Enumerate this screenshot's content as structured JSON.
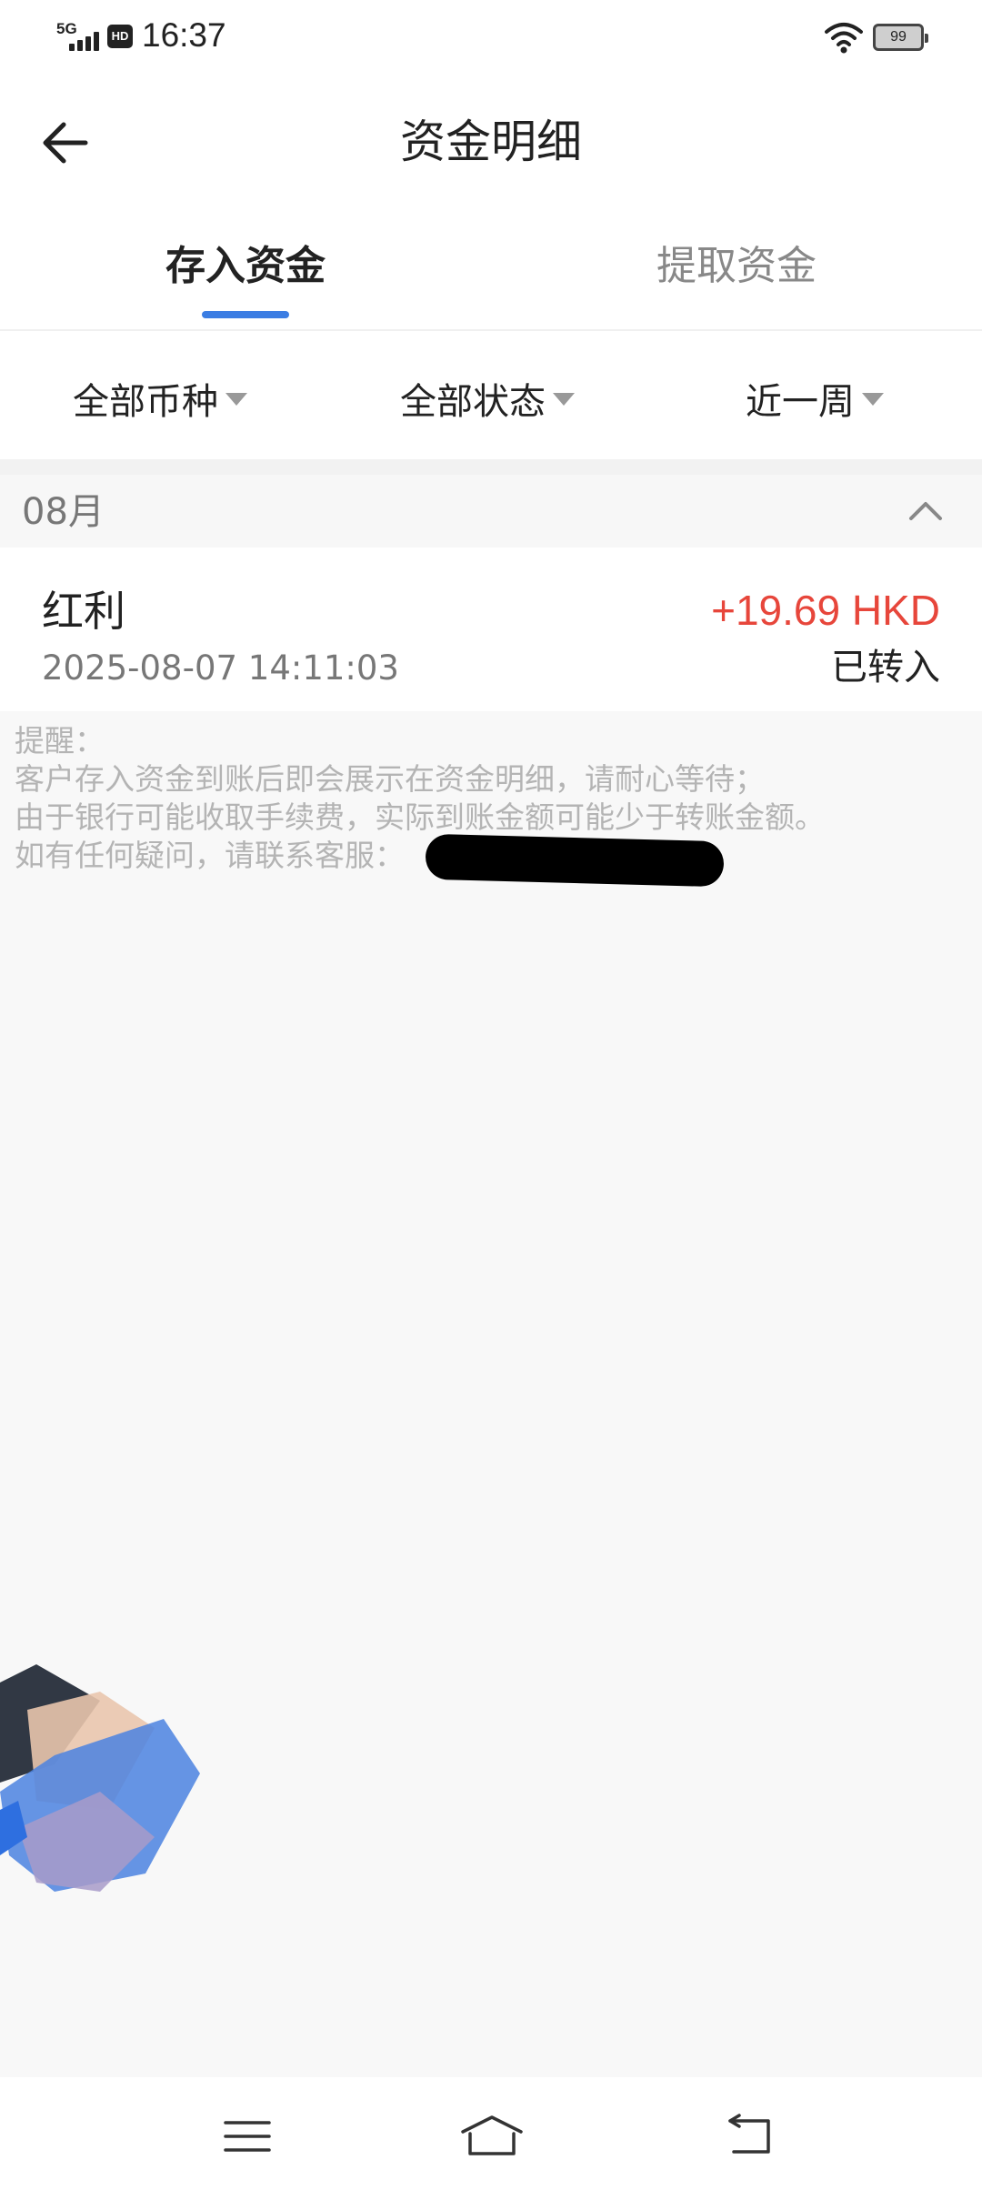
{
  "status_bar": {
    "network": "5G",
    "hd": "HD",
    "time": "16:37",
    "battery": "99",
    "icons": [
      "signal-icon",
      "wifi-icon",
      "battery-icon"
    ]
  },
  "header": {
    "title": "资金明细",
    "back_icon": "arrow-left-icon"
  },
  "tabs": [
    {
      "label": "存入资金",
      "active": true
    },
    {
      "label": "提取资金",
      "active": false
    }
  ],
  "filters": [
    {
      "label": "全部币种"
    },
    {
      "label": "全部状态"
    },
    {
      "label": "近一周"
    }
  ],
  "month_group": {
    "label": "08月",
    "collapse_icon": "chevron-up-icon"
  },
  "transactions": [
    {
      "type": "红利",
      "time": "2025-08-07 14:11:03",
      "amount": "+19.69 HKD",
      "status": "已转入"
    }
  ],
  "notice": {
    "lines": [
      "提醒：",
      "客户存入资金到账后即会展示在资金明细，请耐心等待；",
      "由于银行可能收取手续费，实际到账金额可能少于转账金额。",
      "如有任何疑问，请联系客服："
    ]
  },
  "colors": {
    "accent": "#3b7de3",
    "amount_positive": "#e7463b",
    "muted_text": "#b4b4b4",
    "page_bg": "#f8f8f8"
  },
  "nav_bar": {
    "icons": [
      "menu-icon",
      "home-icon",
      "back-icon"
    ]
  }
}
